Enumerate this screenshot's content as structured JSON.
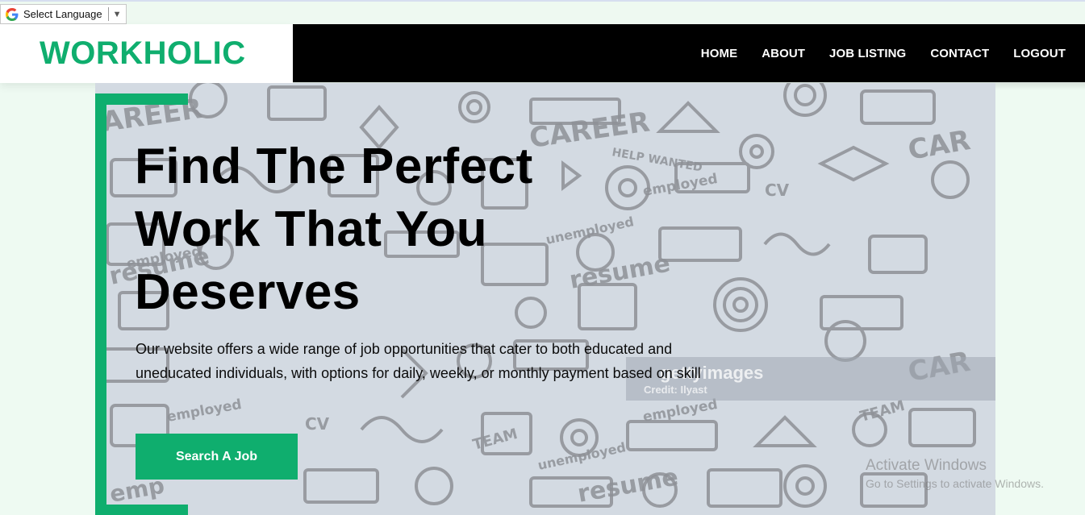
{
  "translate": {
    "label": "Select Language",
    "arrow": "▼",
    "icon": "google-g-icon"
  },
  "header": {
    "brand": "WORKHOLIC",
    "brand_color": "#0fae6e",
    "nav": [
      {
        "label": "HOME"
      },
      {
        "label": "ABOUT"
      },
      {
        "label": "JOB LISTING"
      },
      {
        "label": "CONTACT"
      },
      {
        "label": "LOGOUT"
      }
    ]
  },
  "hero": {
    "headline_line1": "Find The Perfect",
    "headline_line2": "Work That You",
    "headline_line3": "Deserves",
    "description": "Our website offers a wide range of job opportunities that cater to both educated and uneducated individuals, with options for daily, weekly, or monthly payment based on skill",
    "cta_label": "Search A Job",
    "accent_color": "#0fae6e",
    "watermark_text": "gettyimages",
    "watermark_credit": "Credit: Ilyast"
  },
  "os_overlay": {
    "title": "Activate Windows",
    "subtitle": "Go to Settings to activate Windows."
  }
}
